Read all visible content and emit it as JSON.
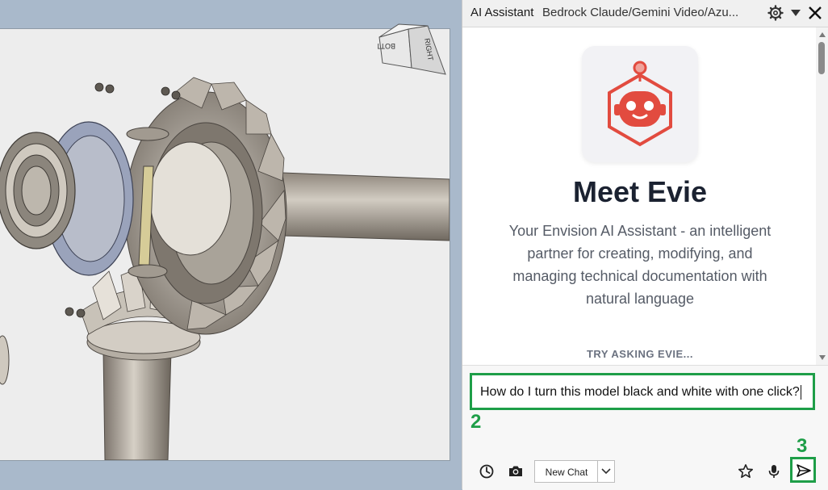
{
  "viewport": {
    "viewcube_faces": [
      "RIGHT",
      "BOTTOM"
    ]
  },
  "panel": {
    "title": "AI Assistant",
    "subtitle": "Bedrock Claude/Gemini Video/Azu...",
    "heading": "Meet Evie",
    "description": "Your Envision AI Assistant - an intelligent partner for creating, modifying, and managing technical documentation with natural language",
    "try_label": "TRY ASKING EVIE...",
    "accent_color": "#1e9e48",
    "brand_color": "#e24b3f"
  },
  "composer": {
    "input_value": "How do I turn this model black and white with one click?",
    "step_input": "2",
    "step_send": "3",
    "new_chat_label": "New Chat",
    "icons": [
      "history-icon",
      "camera-icon",
      "chevron-down-icon",
      "star-icon",
      "microphone-icon",
      "send-icon"
    ]
  }
}
